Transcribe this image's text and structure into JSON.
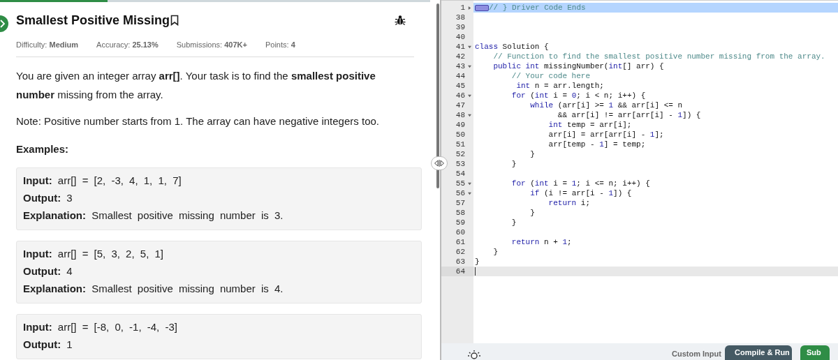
{
  "progress": {
    "level": 0.25
  },
  "problem": {
    "title": "Smallest Positive Missing",
    "bookmarked": false,
    "meta": [
      {
        "label": "Difficulty:",
        "value": "Medium"
      },
      {
        "label": "Accuracy:",
        "value": "25.13%"
      },
      {
        "label": "Submissions:",
        "value": "407K+"
      },
      {
        "label": "Points:",
        "value": "4"
      }
    ],
    "description": "You are given an integer array **arr[]**. Your task is to find the **smallest positive number** missing from the array.",
    "note": "Note: Positive number starts from 1. The array can have negative integers too.",
    "examples_heading": "Examples:",
    "examples": [
      [
        {
          "label": "Input:",
          "text": "arr[] = [2, -3, 4, 1, 1, 7]"
        },
        {
          "label": "Output:",
          "text": "3"
        },
        {
          "label": "Explanation:",
          "text": "Smallest positive missing number is 3."
        }
      ],
      [
        {
          "label": "Input:",
          "text": "arr[] = [5, 3, 2, 5, 1]"
        },
        {
          "label": "Output:",
          "text": "4"
        },
        {
          "label": "Explanation:",
          "text": "Smallest positive missing number is 4."
        }
      ],
      [
        {
          "label": "Input:",
          "text": "arr[] = [-8, 0, -1, -4, -3]"
        },
        {
          "label": "Output:",
          "text": "1"
        }
      ]
    ]
  },
  "editor": {
    "lines": [
      {
        "number": "1",
        "folded": true,
        "highlighted": true,
        "tokens": [
          {
            "kind": "comment",
            "text": "// } Driver Code Ends"
          }
        ]
      },
      {
        "number": "38"
      },
      {
        "number": "39"
      },
      {
        "number": "40"
      },
      {
        "number": "41",
        "folded": false,
        "tokens": [
          {
            "kind": "keyword",
            "text": "class"
          },
          {
            "kind": "plain",
            "text": " Solution {"
          }
        ]
      },
      {
        "number": "42",
        "tokens": [
          {
            "kind": "comment",
            "text": "    // Function to find the smallest positive number missing from the array."
          }
        ]
      },
      {
        "number": "43",
        "folded": false,
        "tokens": [
          {
            "kind": "keyword",
            "text": "    public int"
          },
          {
            "kind": "plain",
            "text": " missingNumber("
          },
          {
            "kind": "keyword",
            "text": "int"
          },
          {
            "kind": "plain",
            "text": "[] arr) {"
          }
        ]
      },
      {
        "number": "44",
        "tokens": [
          {
            "kind": "comment",
            "text": "        // Your code here"
          }
        ]
      },
      {
        "number": "45",
        "tokens": [
          {
            "kind": "keyword",
            "text": "         int"
          },
          {
            "kind": "plain",
            "text": " n = arr.length;"
          }
        ]
      },
      {
        "number": "46",
        "folded": false,
        "tokens": [
          {
            "kind": "keyword",
            "text": "        for"
          },
          {
            "kind": "plain",
            "text": " ("
          },
          {
            "kind": "keyword",
            "text": "int"
          },
          {
            "kind": "plain",
            "text": " i = "
          },
          {
            "kind": "number",
            "text": "0"
          },
          {
            "kind": "plain",
            "text": "; i < n; i++) {"
          }
        ]
      },
      {
        "number": "47",
        "tokens": [
          {
            "kind": "keyword",
            "text": "            while"
          },
          {
            "kind": "plain",
            "text": " (arr[i] >= "
          },
          {
            "kind": "number",
            "text": "1"
          },
          {
            "kind": "plain",
            "text": " && arr[i] <= n"
          }
        ]
      },
      {
        "number": "48",
        "folded": false,
        "tokens": [
          {
            "kind": "plain",
            "text": "                  && arr[i] != arr[arr[i] - "
          },
          {
            "kind": "number",
            "text": "1"
          },
          {
            "kind": "plain",
            "text": "]) {"
          }
        ]
      },
      {
        "number": "49",
        "tokens": [
          {
            "kind": "keyword",
            "text": "                int"
          },
          {
            "kind": "plain",
            "text": " temp = arr[i];"
          }
        ]
      },
      {
        "number": "50",
        "tokens": [
          {
            "kind": "plain",
            "text": "                arr[i] = arr[arr[i] - "
          },
          {
            "kind": "number",
            "text": "1"
          },
          {
            "kind": "plain",
            "text": "];"
          }
        ]
      },
      {
        "number": "51",
        "tokens": [
          {
            "kind": "plain",
            "text": "                arr[temp - "
          },
          {
            "kind": "number",
            "text": "1"
          },
          {
            "kind": "plain",
            "text": "] = temp;"
          }
        ]
      },
      {
        "number": "52",
        "tokens": [
          {
            "kind": "plain",
            "text": "            }"
          }
        ]
      },
      {
        "number": "53",
        "tokens": [
          {
            "kind": "plain",
            "text": "        }"
          }
        ]
      },
      {
        "number": "54"
      },
      {
        "number": "55",
        "folded": false,
        "tokens": [
          {
            "kind": "keyword",
            "text": "        for"
          },
          {
            "kind": "plain",
            "text": " ("
          },
          {
            "kind": "keyword",
            "text": "int"
          },
          {
            "kind": "plain",
            "text": " i = "
          },
          {
            "kind": "number",
            "text": "1"
          },
          {
            "kind": "plain",
            "text": "; i <= n; i++) {"
          }
        ]
      },
      {
        "number": "56",
        "folded": false,
        "tokens": [
          {
            "kind": "keyword",
            "text": "            if"
          },
          {
            "kind": "plain",
            "text": " (i != arr[i - "
          },
          {
            "kind": "number",
            "text": "1"
          },
          {
            "kind": "plain",
            "text": "]) {"
          }
        ]
      },
      {
        "number": "57",
        "tokens": [
          {
            "kind": "keyword",
            "text": "                return"
          },
          {
            "kind": "plain",
            "text": " i;"
          }
        ]
      },
      {
        "number": "58",
        "tokens": [
          {
            "kind": "plain",
            "text": "            }"
          }
        ]
      },
      {
        "number": "59",
        "tokens": [
          {
            "kind": "plain",
            "text": "        }"
          }
        ]
      },
      {
        "number": "60"
      },
      {
        "number": "61",
        "tokens": [
          {
            "kind": "keyword",
            "text": "        return"
          },
          {
            "kind": "plain",
            "text": " n + "
          },
          {
            "kind": "number",
            "text": "1"
          },
          {
            "kind": "plain",
            "text": ";"
          }
        ]
      },
      {
        "number": "62",
        "tokens": [
          {
            "kind": "plain",
            "text": "    }"
          }
        ]
      },
      {
        "number": "63",
        "tokens": [
          {
            "kind": "plain",
            "text": "}"
          }
        ]
      },
      {
        "number": "64",
        "cursor": true
      }
    ]
  },
  "footer": {
    "custom_input": "Custom Input",
    "buttons": [
      {
        "label": "Compile & Run",
        "kind": "secondary"
      },
      {
        "label": "Sub",
        "kind": "primary"
      }
    ]
  }
}
